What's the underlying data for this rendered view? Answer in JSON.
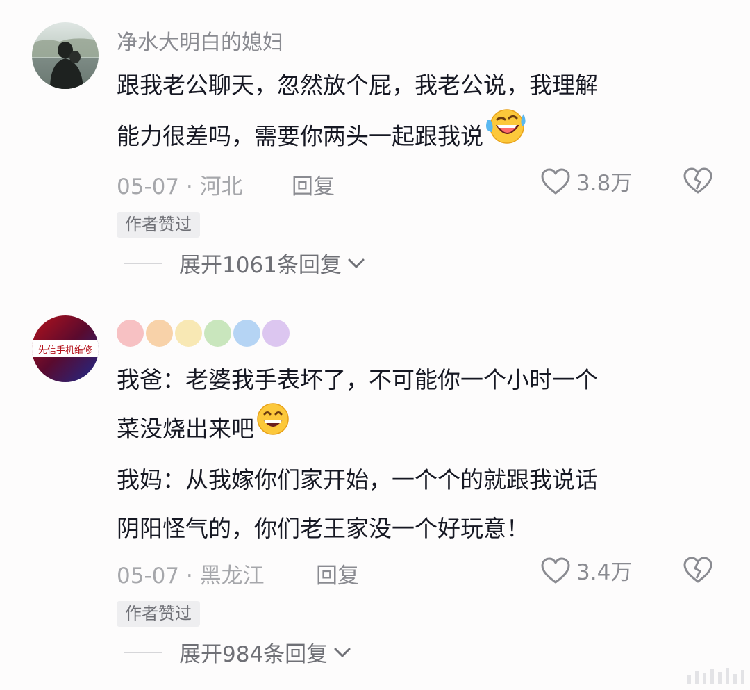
{
  "comments": [
    {
      "username": "净水大明白的媳妇",
      "text_lines": [
        "跟我老公聊天，忽然放个屁，我老公说，我理解",
        "能力很差吗，需要你两头一起跟我说"
      ],
      "emoji": "laughing-crying-emoji",
      "date": "05-07 · 河北",
      "reply_label": "回复",
      "likes": "3.8万",
      "badge": "作者赞过",
      "expand_label": "展开1061条回复"
    },
    {
      "username_dot_colors": [
        "#f7c1c3",
        "#f8d2a9",
        "#f8e8b4",
        "#c9e6bd",
        "#b5d4f4",
        "#dcc6f0"
      ],
      "avatar_text": "先信手机维修",
      "text_lines": [
        "我爸：老婆我手表坏了，不可能你一个小时一个",
        "菜没烧出来吧",
        "我妈：从我嫁你们家开始，一个个的就跟我说话",
        "阴阳怪气的，你们老王家没一个好玩意！"
      ],
      "emoji": "grinning-emoji",
      "date": "05-07 · 黑龙江",
      "reply_label": "回复",
      "likes": "3.4万",
      "badge": "作者赞过",
      "expand_label": "展开984条回复"
    }
  ],
  "colors": {
    "background": "#fdfcfc",
    "text": "#161823",
    "muted": "#a6a7ab",
    "badge_bg": "#eeeef0"
  }
}
